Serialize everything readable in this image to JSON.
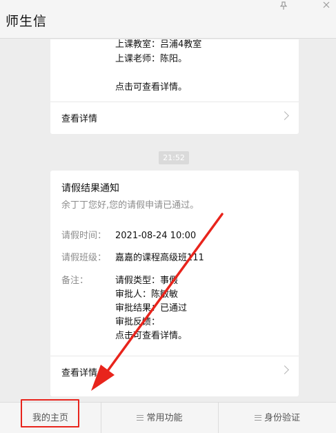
{
  "app": {
    "title": "师生信",
    "pin_icon": "pin-icon",
    "close_icon": "close-icon"
  },
  "card_top": {
    "lines": [
      "上课教室：吕浦4教室",
      "上课老师：陈阳。"
    ],
    "footer_note": "点击可查看详情。",
    "detail_link": "查看详情"
  },
  "timestamp": "21:52",
  "card_leave": {
    "title": "请假结果通知",
    "greeting": "余丁丁您好,您的请假申请已通过。",
    "fields": [
      {
        "label": "请假时间：",
        "value": "2021-08-24 10:00"
      },
      {
        "label": "请假班级：",
        "value": "嘉嘉的课程高级班111"
      }
    ],
    "remark_label": "备注：",
    "remark_lines": [
      "请假类型：事假",
      "审批人：陈敏敏",
      "审批结果：已通过",
      "审批反馈：",
      "点击可查看详情。"
    ],
    "detail_link": "查看详情"
  },
  "tabbar": {
    "tabs": [
      {
        "label": "我的主页"
      },
      {
        "label": "常用功能"
      },
      {
        "label": "身份验证"
      }
    ]
  },
  "annotation_color": "#e8241c"
}
